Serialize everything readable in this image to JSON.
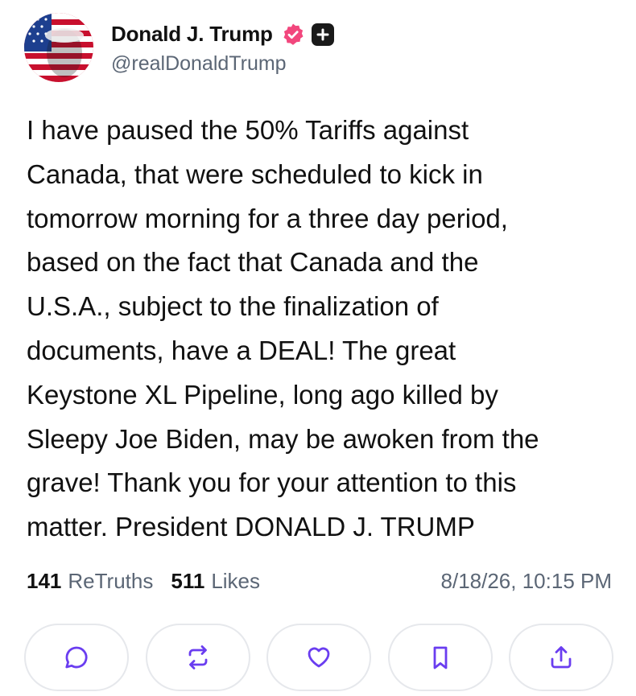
{
  "author": {
    "name": "Donald J. Trump",
    "handle": "@realDonaldTrump",
    "verified_color": "#f2477d",
    "badge_icon": "plus-badge-icon"
  },
  "post": {
    "lines": [
      "I have paused the 50% Tariffs against",
      "Canada, that were scheduled to kick in",
      "tomorrow morning for a three day period,",
      "based on the fact that Canada and the",
      "U.S.A., subject to the finalization of",
      "documents, have a DEAL! The great",
      "Keystone XL Pipeline, long ago killed by",
      "Sleepy Joe Biden, may be awoken from the",
      "grave! Thank you for your attention to this",
      "matter. President DONALD J. TRUMP"
    ]
  },
  "stats": {
    "retruths_count": "141",
    "retruths_label": "ReTruths",
    "likes_count": "511",
    "likes_label": "Likes",
    "timestamp": "8/18/26, 10:15 PM"
  },
  "actions": [
    "reply-icon",
    "retruth-icon",
    "like-icon",
    "bookmark-icon",
    "share-icon"
  ],
  "colors": {
    "accent": "#6a3df0",
    "muted_text": "#5b6675",
    "button_border": "#e6e8ec"
  }
}
